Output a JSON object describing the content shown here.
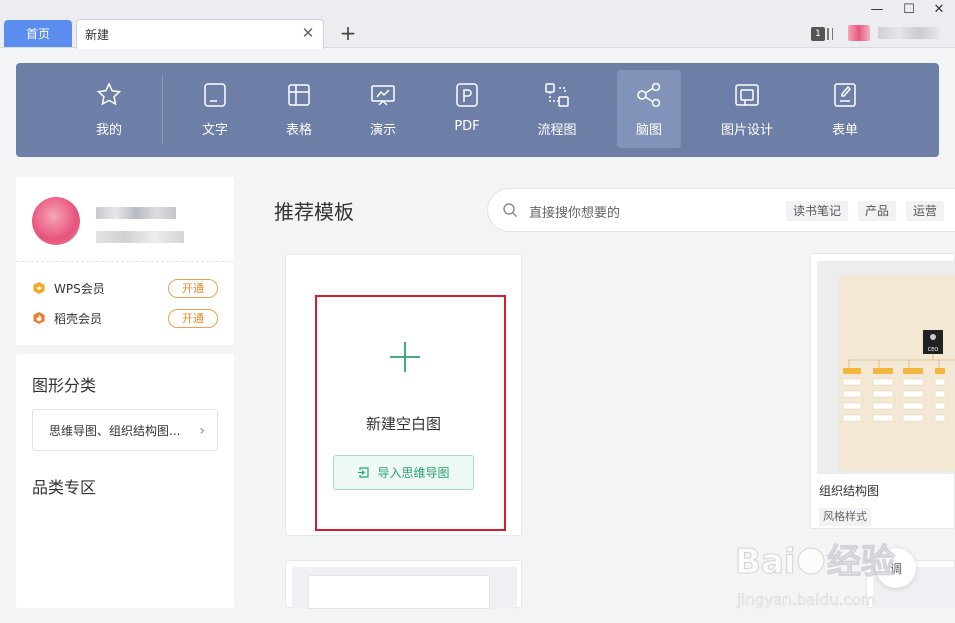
{
  "tabs": {
    "home": "首页",
    "current": "新建",
    "close_glyph": "✕",
    "add_glyph": "+"
  },
  "window": {
    "badge_count": "1",
    "minimize": "—",
    "maximize": "☐",
    "close": "✕"
  },
  "toolbar": {
    "items": [
      {
        "label": "我的",
        "icon": "star-icon"
      },
      {
        "label": "文字",
        "icon": "doc-icon"
      },
      {
        "label": "表格",
        "icon": "table-icon"
      },
      {
        "label": "演示",
        "icon": "presentation-icon"
      },
      {
        "label": "PDF",
        "icon": "pdf-icon"
      },
      {
        "label": "流程图",
        "icon": "flowchart-icon"
      },
      {
        "label": "脑图",
        "icon": "mindmap-icon",
        "active": true
      },
      {
        "label": "图片设计",
        "icon": "image-design-icon"
      },
      {
        "label": "表单",
        "icon": "form-icon"
      }
    ],
    "bg_color": "#6d7fa6"
  },
  "profile": {
    "memberships": [
      {
        "label": "WPS会员",
        "action": "开通",
        "icon": "crown-icon"
      },
      {
        "label": "稻壳会员",
        "action": "开通",
        "icon": "flame-icon"
      }
    ]
  },
  "category": {
    "title": "图形分类",
    "select_value": "思维导图、组织结构图...",
    "zone_title": "品类专区"
  },
  "main": {
    "section_title": "推荐模板",
    "search_placeholder": "直接搜你想要的",
    "tags": [
      "读书笔记",
      "产品",
      "运营"
    ],
    "blank": {
      "label": "新建空白图",
      "import_label": "导入思维导图"
    },
    "template": {
      "name": "组织结构图",
      "badge": "风格样式",
      "thumb_badge": "CEO"
    },
    "float_label": "调"
  },
  "colors": {
    "accent_green": "#2aa474",
    "member_orange": "#f08a24",
    "highlight_red": "#d81e2a",
    "tab_blue": "#5b8def"
  }
}
